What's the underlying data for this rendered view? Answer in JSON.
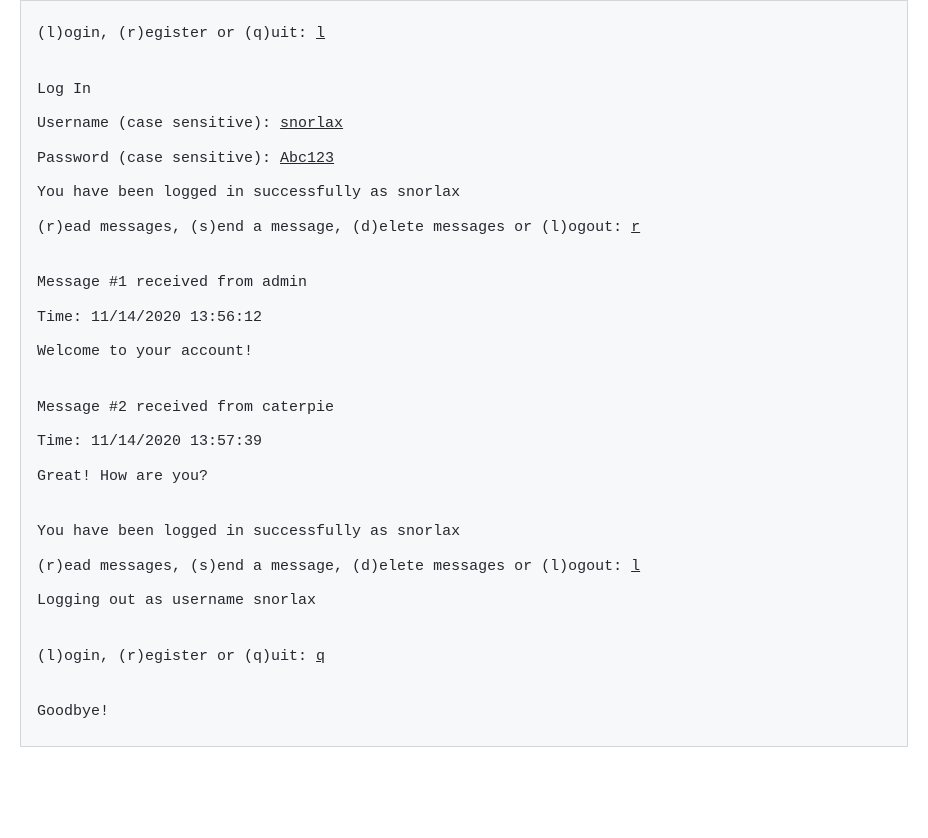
{
  "transcript": {
    "auth_prompt_1": "(l)ogin, (r)egister or (q)uit: ",
    "auth_input_1": "l",
    "blank1": "",
    "login_header": "Log In",
    "username_prompt": "Username (case sensitive): ",
    "username_input": "snorlax",
    "password_prompt": "Password (case sensitive): ",
    "password_input": "Abc123",
    "login_success_1": "You have been logged in successfully as snorlax",
    "action_prompt_1": "(r)ead messages, (s)end a message, (d)elete messages or (l)ogout: ",
    "action_input_1": "r",
    "blank2": "",
    "msg1_header": "Message #1 received from admin",
    "msg1_time": "Time: 11/14/2020 13:56:12",
    "msg1_body": "Welcome to your account!",
    "blank3": "",
    "msg2_header": "Message #2 received from caterpie",
    "msg2_time": "Time: 11/14/2020 13:57:39",
    "msg2_body": "Great! How are you?",
    "blank4": "",
    "login_success_2": "You have been logged in successfully as snorlax",
    "action_prompt_2": "(r)ead messages, (s)end a message, (d)elete messages or (l)ogout: ",
    "action_input_2": "l",
    "logout_msg": "Logging out as username snorlax",
    "blank5": "",
    "auth_prompt_2": "(l)ogin, (r)egister or (q)uit: ",
    "auth_input_2": "q",
    "blank6": "",
    "goodbye": "Goodbye!"
  }
}
